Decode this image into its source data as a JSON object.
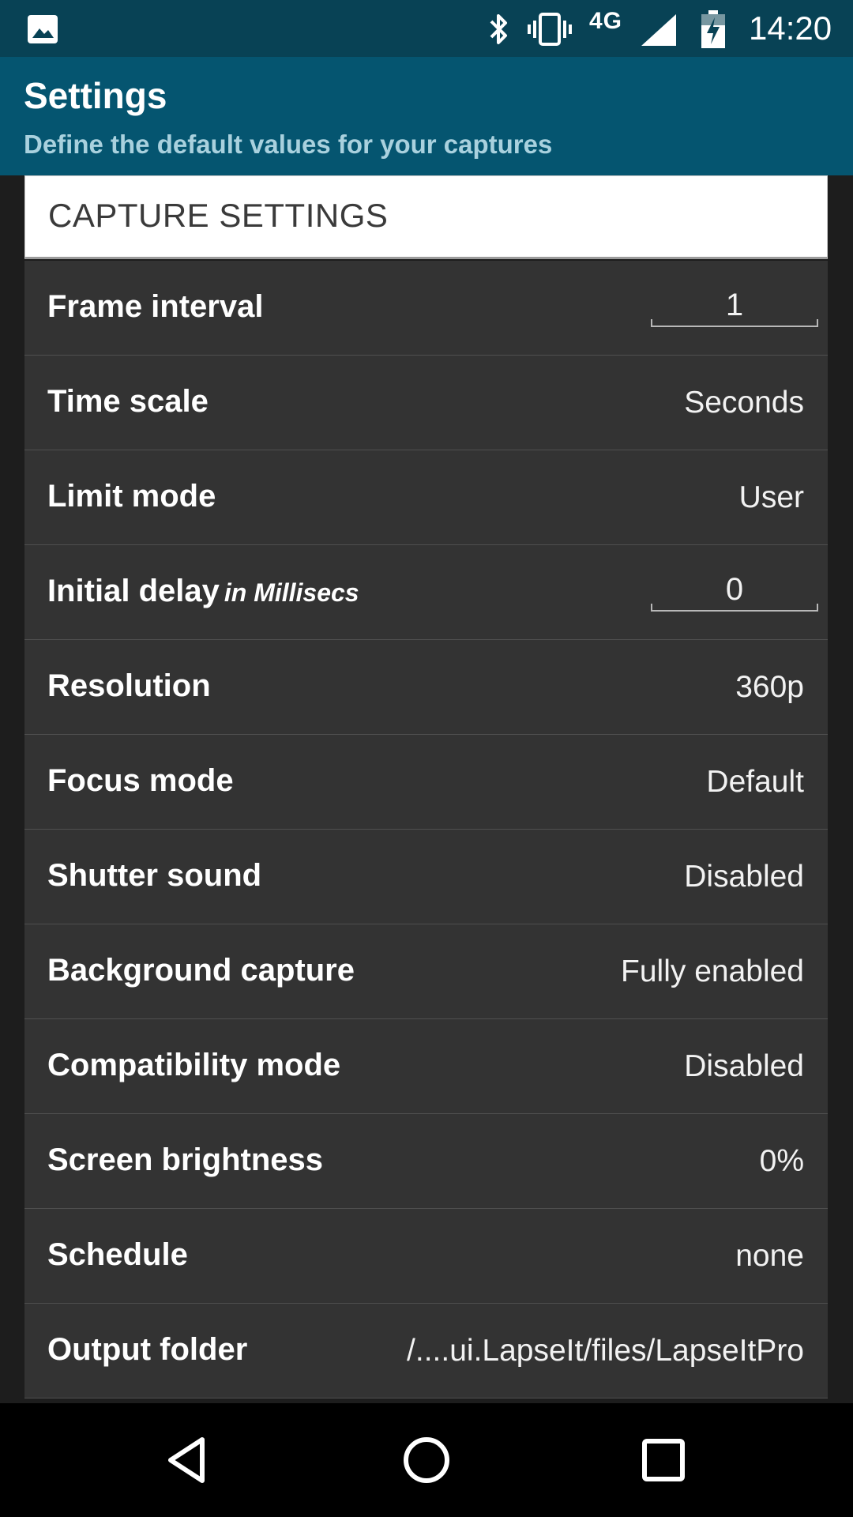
{
  "status_bar": {
    "network": "4G",
    "time": "14:20",
    "icons": [
      "gallery-icon",
      "bluetooth-icon",
      "vibrate-icon",
      "signal-icon",
      "battery-charging-icon"
    ]
  },
  "app_bar": {
    "title": "Settings",
    "subtitle": "Define the default values for your captures"
  },
  "section": {
    "title": "CAPTURE SETTINGS"
  },
  "settings": [
    {
      "label": "Frame interval",
      "value": "1",
      "kind": "input"
    },
    {
      "label": "Time scale",
      "value": "Seconds",
      "kind": "value"
    },
    {
      "label": "Limit mode",
      "value": "User",
      "kind": "value"
    },
    {
      "label": "Initial delay",
      "hint": "in Millisecs",
      "value": "0",
      "kind": "input"
    },
    {
      "label": "Resolution",
      "value": "360p",
      "kind": "value"
    },
    {
      "label": "Focus mode",
      "value": "Default",
      "kind": "value"
    },
    {
      "label": "Shutter sound",
      "value": "Disabled",
      "kind": "value"
    },
    {
      "label": "Background capture",
      "value": "Fully enabled",
      "kind": "value"
    },
    {
      "label": "Compatibility mode",
      "value": "Disabled",
      "kind": "value"
    },
    {
      "label": "Screen brightness",
      "value": "0%",
      "kind": "value"
    },
    {
      "label": "Schedule",
      "value": "none",
      "kind": "value"
    },
    {
      "label": "Output folder",
      "value": "/....ui.LapseIt/files/LapseItPro",
      "kind": "value"
    }
  ],
  "nav_bar": {
    "buttons": [
      "back-icon",
      "home-icon",
      "recents-icon"
    ]
  },
  "colors": {
    "status_bar": "#084255",
    "app_bar": "#055570",
    "subtitle": "#a9d1de",
    "row_background": "#333333",
    "page_background": "#1d1d1d",
    "nav_bar": "#000000"
  }
}
